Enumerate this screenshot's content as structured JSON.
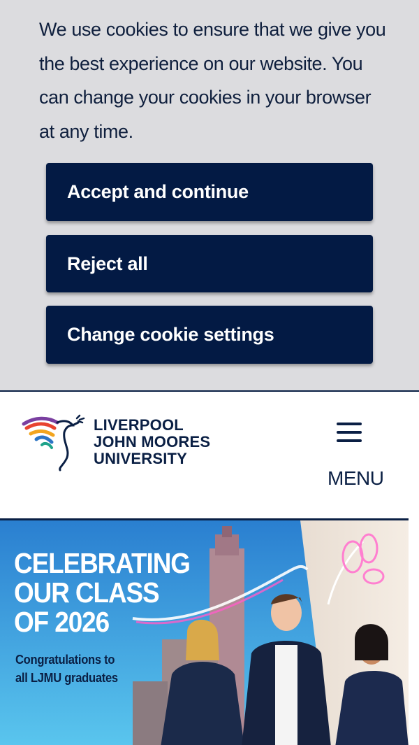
{
  "cookie_banner": {
    "message": "We use cookies to ensure that we give you the best experience on our website. You can change your cookies in your browser at any time.",
    "accept_label": "Accept and continue",
    "reject_label": "Reject all",
    "settings_label": "Change cookie settings"
  },
  "header": {
    "logo_lines": [
      "LIVERPOOL",
      "JOHN MOORES",
      "UNIVERSITY"
    ],
    "menu_label": "MENU"
  },
  "hero": {
    "title_lines": [
      "CELEBRATING",
      "OUR CLASS",
      "OF 2026"
    ],
    "subtitle_lines": [
      "Congratulations to",
      "all LJMU graduates"
    ]
  },
  "colors": {
    "navy": "#031a44",
    "banner_background": "#dcdcdf",
    "hero_sky": "#2f8fd8"
  },
  "icons": [
    "bird-logo-icon",
    "hamburger-menu-icon"
  ]
}
